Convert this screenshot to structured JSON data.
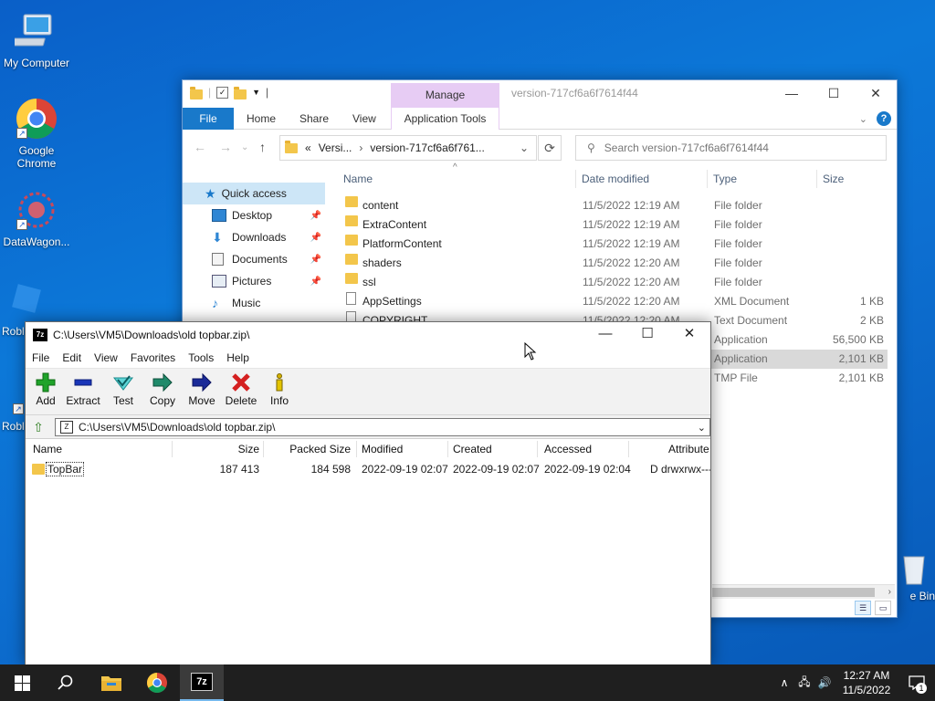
{
  "desktop": {
    "icons": [
      {
        "label": "My Computer"
      },
      {
        "label": "Google Chrome"
      },
      {
        "label": "DataWagon..."
      },
      {
        "label": "Robl"
      },
      {
        "label": "Robl"
      },
      {
        "label": "e Bin"
      }
    ]
  },
  "explorer": {
    "title": "version-717cf6a6f7614f44",
    "manage_label": "Manage",
    "tabs": [
      "File",
      "Home",
      "Share",
      "View",
      "Application Tools"
    ],
    "window_buttons": {
      "minimize": "—",
      "maximize": "☐",
      "close": "✕"
    },
    "address": {
      "prefix": "«",
      "crumb1": "Versi...",
      "crumb2": "version-717cf6a6f761..."
    },
    "search_placeholder": "Search version-717cf6a6f7614f44",
    "nav": [
      {
        "label": "Quick access",
        "icon": "star-icon",
        "pinned": false
      },
      {
        "label": "Desktop",
        "icon": "desktop-icon",
        "pinned": true
      },
      {
        "label": "Downloads",
        "icon": "download-icon",
        "pinned": true
      },
      {
        "label": "Documents",
        "icon": "document-icon",
        "pinned": true
      },
      {
        "label": "Pictures",
        "icon": "picture-icon",
        "pinned": true
      },
      {
        "label": "Music",
        "icon": "music-icon",
        "pinned": false
      }
    ],
    "columns": {
      "name": "Name",
      "date": "Date modified",
      "type": "Type",
      "size": "Size"
    },
    "files": [
      {
        "name": "content",
        "date": "11/5/2022 12:19 AM",
        "type": "File folder",
        "size": "",
        "kind": "folder"
      },
      {
        "name": "ExtraContent",
        "date": "11/5/2022 12:19 AM",
        "type": "File folder",
        "size": "",
        "kind": "folder"
      },
      {
        "name": "PlatformContent",
        "date": "11/5/2022 12:19 AM",
        "type": "File folder",
        "size": "",
        "kind": "folder"
      },
      {
        "name": "shaders",
        "date": "11/5/2022 12:20 AM",
        "type": "File folder",
        "size": "",
        "kind": "folder"
      },
      {
        "name": "ssl",
        "date": "11/5/2022 12:20 AM",
        "type": "File folder",
        "size": "",
        "kind": "folder"
      },
      {
        "name": "AppSettings",
        "date": "11/5/2022 12:20 AM",
        "type": "XML Document",
        "size": "1 KB",
        "kind": "xml"
      },
      {
        "name": "COPYRIGHT",
        "date": "11/5/2022 12:20 AM",
        "type": "Text Document",
        "size": "2 KB",
        "kind": "doc"
      },
      {
        "name": "",
        "date": "",
        "type": "Application",
        "size": "56,500 KB",
        "kind": "app"
      },
      {
        "name": "",
        "date": "",
        "type": "Application",
        "size": "2,101 KB",
        "kind": "app",
        "highlight": true
      },
      {
        "name": "",
        "date": "",
        "type": "TMP File",
        "size": "2,101 KB",
        "kind": "tmp"
      }
    ]
  },
  "sevenzip": {
    "title": "C:\\Users\\VM5\\Downloads\\old topbar.zip\\",
    "logo": "7z",
    "menu": [
      "File",
      "Edit",
      "View",
      "Favorites",
      "Tools",
      "Help"
    ],
    "tools": [
      "Add",
      "Extract",
      "Test",
      "Copy",
      "Move",
      "Delete",
      "Info"
    ],
    "path": "C:\\Users\\VM5\\Downloads\\old topbar.zip\\",
    "columns": {
      "name": "Name",
      "size": "Size",
      "packed": "Packed Size",
      "modified": "Modified",
      "created": "Created",
      "accessed": "Accessed",
      "attributes": "Attribute"
    },
    "rows": [
      {
        "name": "TopBar",
        "size": "187 413",
        "packed": "184 598",
        "modified": "2022-09-19 02:07",
        "created": "2022-09-19 02:07",
        "accessed": "2022-09-19 02:04",
        "attributes": "D drwxrwx---"
      }
    ]
  },
  "taskbar": {
    "clock_time": "12:27 AM",
    "clock_date": "11/5/2022",
    "notification_count": "1",
    "sevenzip_label": "7z"
  },
  "colors": {
    "accent": "#1979ca",
    "manage": "#e7ccf4",
    "taskbar": "#1f1f1f"
  }
}
